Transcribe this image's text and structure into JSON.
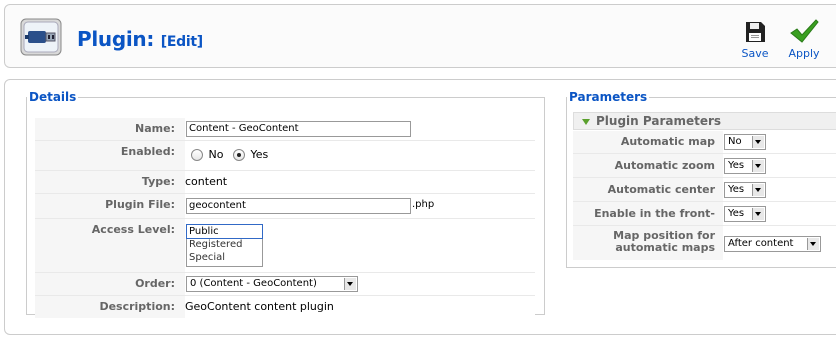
{
  "header": {
    "title": "Plugin:",
    "subtitle": "[Edit]",
    "icon": "plugin-icon"
  },
  "toolbar": {
    "save_label": "Save",
    "apply_label": "Apply"
  },
  "details": {
    "legend": "Details",
    "name_label": "Name:",
    "name_value": "Content - GeoContent",
    "enabled_label": "Enabled:",
    "enabled_no": "No",
    "enabled_yes": "Yes",
    "enabled_selected": "Yes",
    "type_label": "Type:",
    "type_value": "content",
    "file_label": "Plugin File:",
    "file_value": "geocontent",
    "file_ext": ".php",
    "access_label": "Access Level:",
    "access_options": [
      "Public",
      "Registered",
      "Special"
    ],
    "access_selected": "Public",
    "order_label": "Order:",
    "order_value": "0 (Content - GeoContent)",
    "desc_label": "Description:",
    "desc_value": "GeoContent content plugin"
  },
  "parameters": {
    "legend": "Parameters",
    "panel_title": "Plugin Parameters",
    "rows": [
      {
        "label": "Automatic map",
        "value": "No"
      },
      {
        "label": "Automatic zoom",
        "value": "Yes"
      },
      {
        "label": "Automatic center",
        "value": "Yes"
      },
      {
        "label": "Enable in the front-page",
        "value": "Yes"
      },
      {
        "label": "Map position for automatic maps",
        "value": "After content"
      }
    ]
  },
  "colors": {
    "title": "#0b55c4",
    "apply_check": "#3aa020"
  }
}
